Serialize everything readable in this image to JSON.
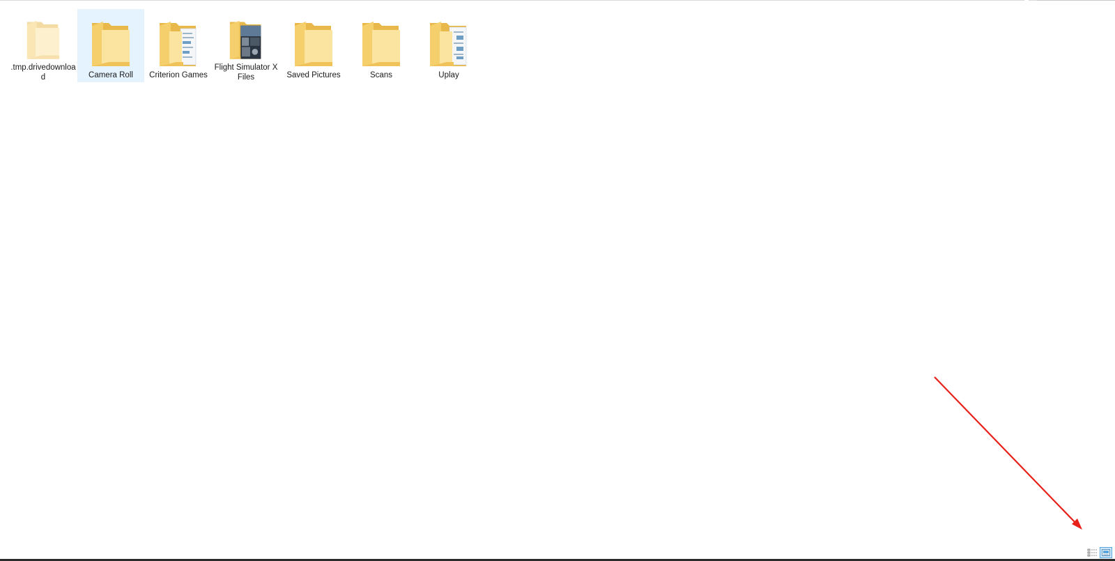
{
  "window": {
    "title": ""
  },
  "file_list": {
    "items": [
      {
        "name": ".tmp.drivedownload",
        "icon": "folder-icon",
        "selected": false,
        "faded": true
      },
      {
        "name": "Camera Roll",
        "icon": "folder-icon",
        "selected": true,
        "faded": false
      },
      {
        "name": "Criterion Games",
        "icon": "folder-documents-icon",
        "selected": false,
        "faded": false
      },
      {
        "name": "Flight Simulator X Files",
        "icon": "folder-image-preview-icon",
        "selected": false,
        "faded": false
      },
      {
        "name": "Saved Pictures",
        "icon": "folder-icon",
        "selected": false,
        "faded": false
      },
      {
        "name": "Scans",
        "icon": "folder-icon",
        "selected": false,
        "faded": false
      },
      {
        "name": "Uplay",
        "icon": "folder-documents-icon",
        "selected": false,
        "faded": false
      }
    ]
  },
  "status_bar": {
    "details_view": {
      "icon": "details-view-icon",
      "active": false
    },
    "large_icons_view": {
      "icon": "large-icons-view-icon",
      "active": true
    }
  },
  "colors": {
    "folder": "#f7d77a",
    "folder_dark": "#e8b94a",
    "selection": "#e5f3ff",
    "annotation_arrow": "#e8201a"
  }
}
